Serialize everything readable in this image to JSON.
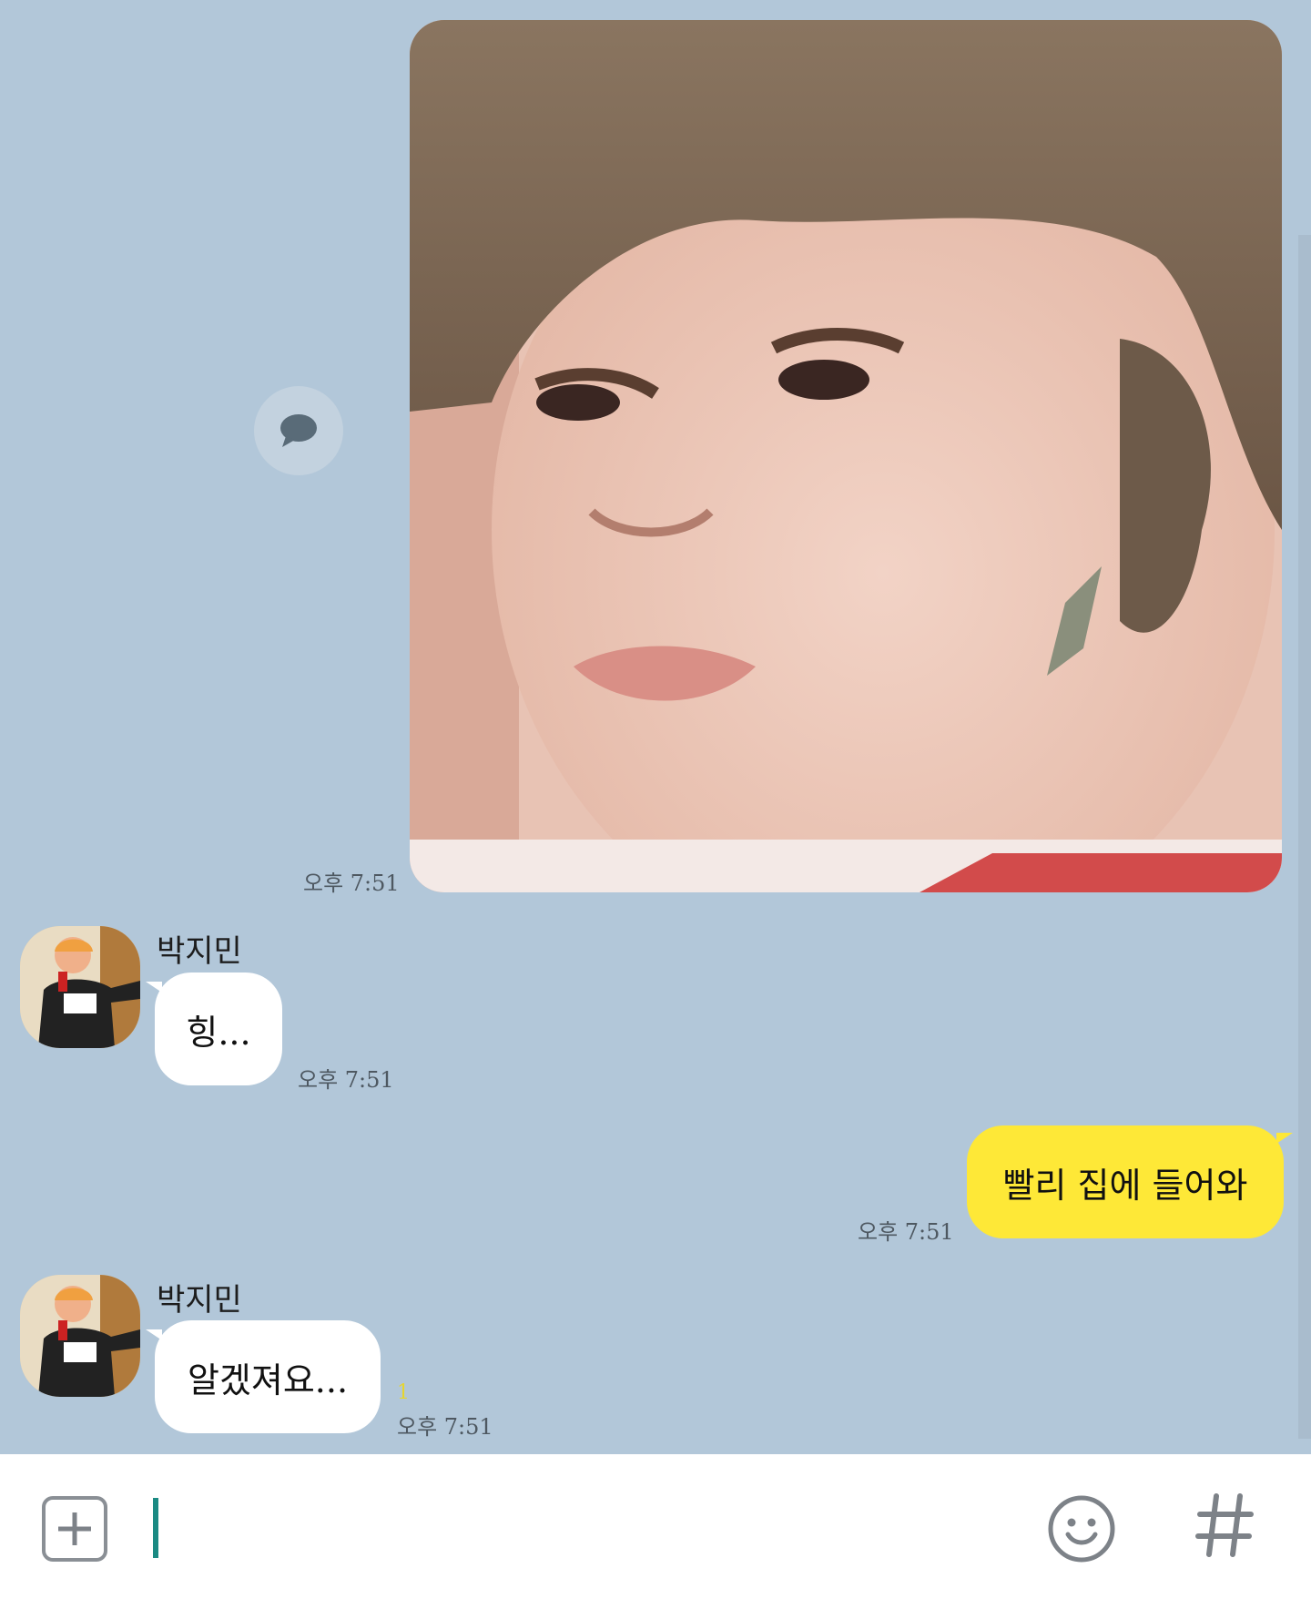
{
  "messages": {
    "image_msg": {
      "time": "오후 7:51"
    },
    "recv1": {
      "sender": "박지민",
      "text": "힝...",
      "time": "오후 7:51"
    },
    "sent1": {
      "text": "빨리 집에 들어와",
      "time": "오후 7:51"
    },
    "recv2": {
      "sender": "박지민",
      "text": "알겠져요...",
      "unread": "1",
      "time": "오후 7:51"
    }
  },
  "icons": {
    "share": "speech-bubble-icon",
    "plus": "plus-icon",
    "emoji": "smiley-icon",
    "hash": "hash-icon"
  },
  "colors": {
    "background": "#b2c7d9",
    "sent_bubble": "#fee837",
    "recv_bubble": "#ffffff",
    "unread": "#e6d530",
    "cursor": "#1b8a83"
  }
}
